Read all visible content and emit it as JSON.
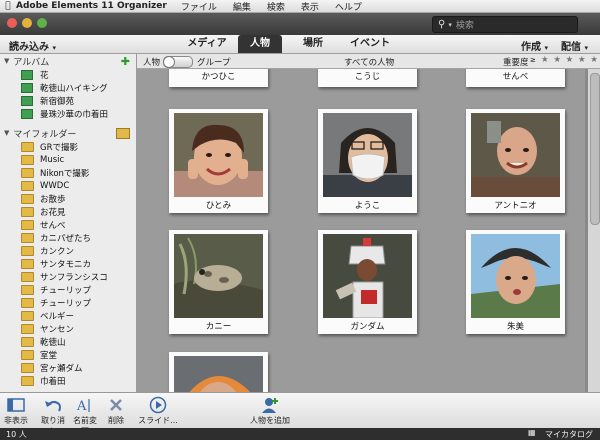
{
  "menubar": {
    "app_name": "Adobe Elements 11 Organizer",
    "items": [
      "ファイル",
      "編集",
      "検索",
      "表示",
      "ヘルプ"
    ]
  },
  "search": {
    "placeholder": "検索"
  },
  "nav": {
    "import_label": "読み込み",
    "tabs": [
      "メディア",
      "人物",
      "場所",
      "イベント"
    ],
    "active_tab": "人物",
    "create_label": "作成",
    "share_label": "配信"
  },
  "sidebar": {
    "albums_header": "アルバム",
    "albums": [
      "花",
      "乾徳山ハイキング",
      "新宿御苑",
      "曼珠沙華の巾着田"
    ],
    "folders_header": "マイフォルダー",
    "folders": [
      "GRで撮影",
      "Music",
      "Nikonで撮影",
      "WWDC",
      "お散歩",
      "お花見",
      "せんべ",
      "カニパぜたち",
      "カンクン",
      "サンタモニカ",
      "サンフランシスコ",
      "チューリップ",
      "チューリップ",
      "ベルギー",
      "ヤンセン",
      "乾徳山",
      "室堂",
      "宮ヶ瀬ダム",
      "巾着田"
    ]
  },
  "subbar": {
    "person_label": "人物",
    "group_label": "グループ",
    "title": "すべての人物",
    "importance_label": "重要度",
    "stars": "★ ★ ★ ★ ★"
  },
  "people": [
    "かつひこ",
    "こうじ",
    "せんべ",
    "ひとみ",
    "ようこ",
    "アントニオ",
    "カニー",
    "ガンダム",
    "朱美"
  ],
  "toolbar": {
    "hide": "非表示",
    "undo": "取り消し",
    "rename": "名前変更",
    "delete": "削除",
    "slideshow": "スライド...",
    "add_person": "人物を追加"
  },
  "status": {
    "count": "10 人",
    "catalog": "マイカタログ"
  },
  "colors": {
    "accent_green": "#3fa054",
    "folder_yellow": "#e3b948",
    "active_tab_bg": "#333333"
  }
}
